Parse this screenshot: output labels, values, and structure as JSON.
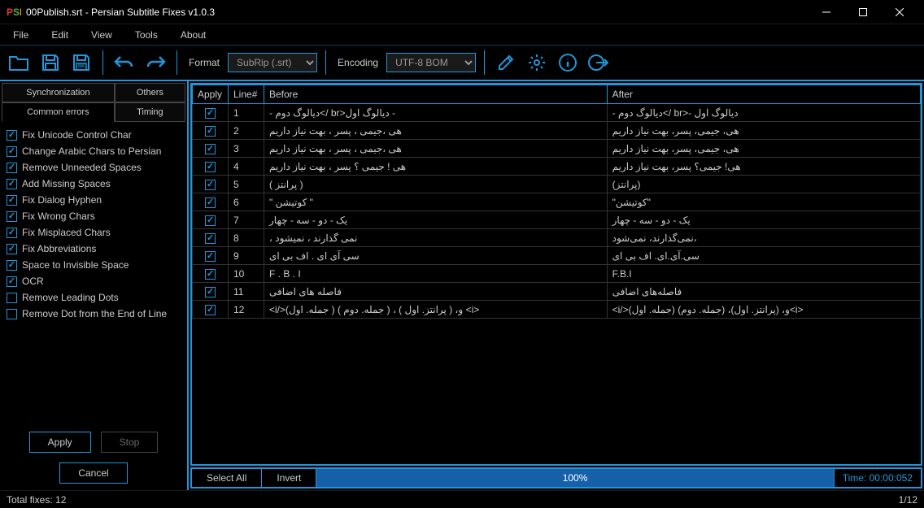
{
  "window": {
    "title": "00Publish.srt - Persian Subtitle Fixes v1.0.3"
  },
  "menu": {
    "file": "File",
    "edit": "Edit",
    "view": "View",
    "tools": "Tools",
    "about": "About"
  },
  "toolbar": {
    "format_label": "Format",
    "format_value": "SubRip (.srt)",
    "encoding_label": "Encoding",
    "encoding_value": "UTF-8 BOM"
  },
  "tabs": {
    "sync": "Synchronization",
    "others": "Others",
    "common": "Common errors",
    "timing": "Timing"
  },
  "checks": [
    {
      "label": "Fix Unicode Control Char",
      "checked": true
    },
    {
      "label": "Change Arabic Chars to Persian",
      "checked": true
    },
    {
      "label": "Remove Unneeded Spaces",
      "checked": true
    },
    {
      "label": "Add Missing Spaces",
      "checked": true
    },
    {
      "label": "Fix Dialog Hyphen",
      "checked": true
    },
    {
      "label": "Fix Wrong Chars",
      "checked": true
    },
    {
      "label": "Fix Misplaced Chars",
      "checked": true
    },
    {
      "label": "Fix Abbreviations",
      "checked": true
    },
    {
      "label": "Space to Invisible Space",
      "checked": true
    },
    {
      "label": "OCR",
      "checked": true
    },
    {
      "label": "Remove Leading Dots",
      "checked": false
    },
    {
      "label": "Remove Dot from the End of Line",
      "checked": false
    }
  ],
  "buttons": {
    "apply": "Apply",
    "stop": "Stop",
    "cancel": "Cancel"
  },
  "table": {
    "headers": {
      "apply": "Apply",
      "line": "Line#",
      "before": "Before",
      "after": "After"
    },
    "rows": [
      {
        "line": "1",
        "before": "- دیالوگ دوم</ br>دیالوگ اول -",
        "after": "- دیالوگ دوم</ br>- دیالوگ اول"
      },
      {
        "line": "2",
        "before": "هی ،جیمی ، پسر ، بهت نیاز داریم",
        "after": "هی، جیمی، پسر، بهت نیاز داریم"
      },
      {
        "line": "3",
        "before": "هی ،جیمی ، پسر ، بهت نیاز داریم",
        "after": "هی، جیمی، پسر، بهت نیاز داریم"
      },
      {
        "line": "4",
        "before": "هی ! جیمی ؟ پسر ، بهت نیاز داریم",
        "after": "هی! جیمی؟ پسر، بهت نیاز داریم"
      },
      {
        "line": "5",
        "before": "( پرانتز )",
        "after": "(پرانتز)"
      },
      {
        "line": "6",
        "before": "\" کوتیشن \"",
        "after": "\"کوتیشن\""
      },
      {
        "line": "7",
        "before": "یک - دو  - سه  - چهار",
        "after": "یک - دو - سه - چهار"
      },
      {
        "line": "8",
        "before": "، نمی گذارند ، نمیشود",
        "after": "نمی‌گذارند، نمی‌شود،"
      },
      {
        "line": "9",
        "before": "سی آی ای . اف بی ای",
        "after": "سی.آی.ای. اف بی ای"
      },
      {
        "line": "10",
        "before": "F . B . I",
        "after": "F.B.I"
      },
      {
        "line": "11",
        "before": "فاصله های     اضافی",
        "after": "فاصله‌های اضافی"
      },
      {
        "line": "12",
        "before": "<i/>(جمله. اول ) و، ( پرانتز. اول ) ، ( جمله. دوم ) <i>",
        "after": "<i/>(جمله. اول) و، (پرانتز. اول)، (جمله. دوم)<i>"
      }
    ]
  },
  "lower": {
    "select_all": "Select All",
    "invert": "Invert",
    "progress": "100%",
    "time": "Time: 00:00:052"
  },
  "status": {
    "total": "Total fixes: 12",
    "position": "1/12"
  }
}
